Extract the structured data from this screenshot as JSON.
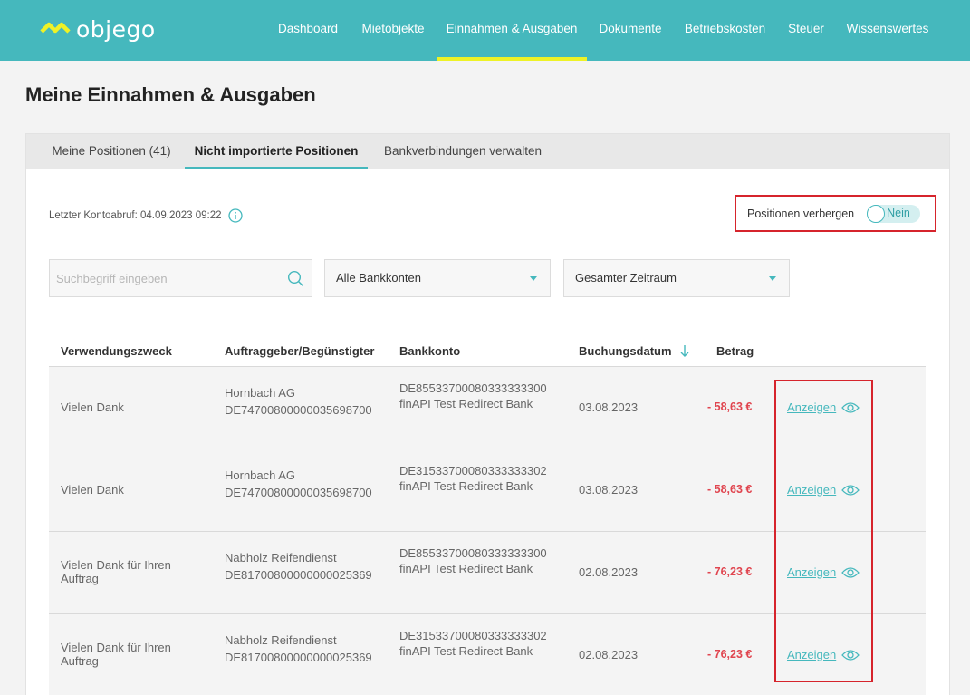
{
  "brand": {
    "name": "objego",
    "accent": "#45b8bd",
    "highlight": "#eef226"
  },
  "nav": [
    {
      "label": "Dashboard"
    },
    {
      "label": "Mietobjekte"
    },
    {
      "label": "Einnahmen & Ausgaben",
      "active": true
    },
    {
      "label": "Dokumente"
    },
    {
      "label": "Betriebskosten"
    },
    {
      "label": "Steuer"
    },
    {
      "label": "Wissenswertes"
    }
  ],
  "page": {
    "title": "Meine Einnahmen & Ausgaben"
  },
  "tabs": [
    {
      "label": "Meine Positionen (41)"
    },
    {
      "label": "Nicht importierte Positionen",
      "active": true
    },
    {
      "label": "Bankverbindungen verwalten"
    }
  ],
  "last_fetch": "Letzter Kontoabruf: 04.09.2023 09:22",
  "hide_positions": {
    "label": "Positionen verbergen",
    "toggle_label": "Nein",
    "on": false
  },
  "search": {
    "placeholder": "Suchbegriff eingeben",
    "value": ""
  },
  "filters": {
    "accounts": {
      "selected": "Alle Bankkonten"
    },
    "period": {
      "selected": "Gesamter Zeitraum"
    }
  },
  "table": {
    "columns": [
      "Verwendungszweck",
      "Auftraggeber/Begünstigter",
      "Bankkonto",
      "Buchungsdatum",
      "Betrag"
    ],
    "sort_column": "Buchungsdatum",
    "sort_direction": "desc",
    "rows": [
      {
        "purpose": "Vielen Dank",
        "payer_name": "Hornbach AG",
        "payer_iban": "DE74700800000035698700",
        "account_iban": "DE85533700080333333300",
        "bank": "finAPI Test Redirect Bank",
        "date": "03.08.2023",
        "amount": "- 58,63 €",
        "action": "Anzeigen"
      },
      {
        "purpose": "Vielen Dank",
        "payer_name": "Hornbach AG",
        "payer_iban": "DE74700800000035698700",
        "account_iban": "DE31533700080333333302",
        "bank": "finAPI Test Redirect Bank",
        "date": "03.08.2023",
        "amount": "- 58,63 €",
        "action": "Anzeigen"
      },
      {
        "purpose": "Vielen Dank für Ihren Auftrag",
        "payer_name": "Nabholz Reifendienst",
        "payer_iban": "DE81700800000000025369",
        "account_iban": "DE85533700080333333300",
        "bank": "finAPI Test Redirect Bank",
        "date": "02.08.2023",
        "amount": "- 76,23 €",
        "action": "Anzeigen"
      },
      {
        "purpose": "Vielen Dank für Ihren Auftrag",
        "payer_name": "Nabholz Reifendienst",
        "payer_iban": "DE81700800000000025369",
        "account_iban": "DE31533700080333333302",
        "bank": "finAPI Test Redirect Bank",
        "date": "02.08.2023",
        "amount": "- 76,23 €",
        "action": "Anzeigen"
      }
    ]
  }
}
